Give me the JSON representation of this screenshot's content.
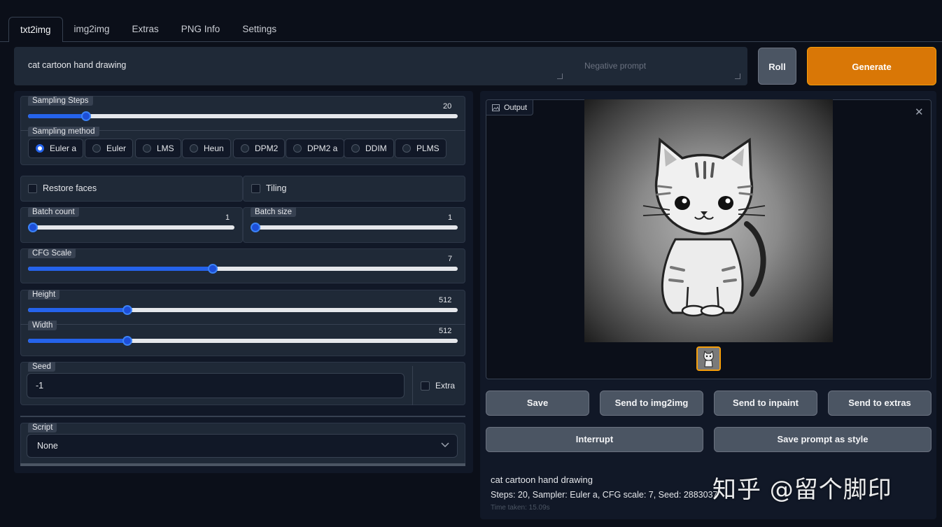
{
  "tabs": [
    "txt2img",
    "img2img",
    "Extras",
    "PNG Info",
    "Settings"
  ],
  "prompt": {
    "value": "cat cartoon hand drawing",
    "negative_placeholder": "Negative prompt"
  },
  "buttons": {
    "roll": "Roll",
    "generate": "Generate",
    "save": "Save",
    "send_img2img": "Send to img2img",
    "send_inpaint": "Send to inpaint",
    "send_extras": "Send to extras",
    "interrupt": "Interrupt",
    "save_style": "Save prompt as style"
  },
  "sampling_steps": {
    "label": "Sampling Steps",
    "value": "20",
    "fraction": 0.27
  },
  "sampling_method": {
    "label": "Sampling method",
    "options": [
      "Euler a",
      "Euler",
      "LMS",
      "Heun",
      "DPM2",
      "DPM2 a",
      "DDIM",
      "PLMS"
    ],
    "selected": "Euler a"
  },
  "restore_faces": {
    "label": "Restore faces",
    "checked": false
  },
  "tiling": {
    "label": "Tiling",
    "checked": false
  },
  "batch_count": {
    "label": "Batch count",
    "value": "1",
    "fraction": 0.0
  },
  "batch_size": {
    "label": "Batch size",
    "value": "1",
    "fraction": 0.0
  },
  "cfg_scale": {
    "label": "CFG Scale",
    "value": "7",
    "fraction": 0.43
  },
  "height": {
    "label": "Height",
    "value": "512",
    "fraction": 0.23
  },
  "width": {
    "label": "Width",
    "value": "512",
    "fraction": 0.23
  },
  "seed": {
    "label": "Seed",
    "value": "-1",
    "extra_label": "Extra"
  },
  "script": {
    "label": "Script",
    "value": "None"
  },
  "output": {
    "label": "Output",
    "info_prompt": "cat cartoon hand drawing",
    "info_params": "Steps: 20, Sampler: Euler a, CFG scale: 7, Seed: 2883037",
    "info_time": "Time taken: 15.09s"
  },
  "watermark": "知乎 @留个脚印",
  "colors": {
    "accent": "#2563eb",
    "generate": "#d97706",
    "background": "#0b0f19",
    "panel": "#1f2937"
  }
}
